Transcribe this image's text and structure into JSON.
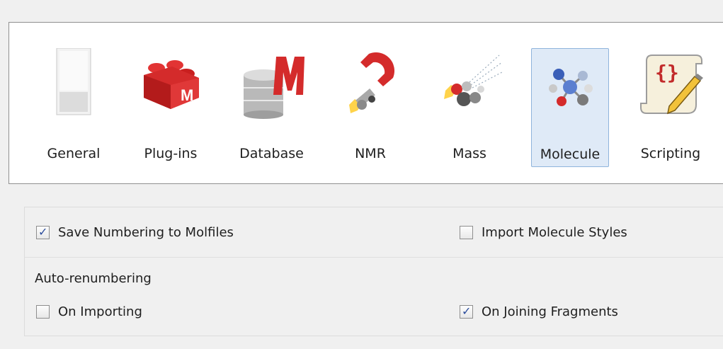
{
  "toolbar": {
    "items": [
      {
        "label": "General",
        "icon": "switch-icon",
        "selected": false
      },
      {
        "label": "Plug-ins",
        "icon": "lego-brick-icon",
        "selected": false
      },
      {
        "label": "Database",
        "icon": "database-icon",
        "selected": false
      },
      {
        "label": "NMR",
        "icon": "magnet-icon",
        "selected": false
      },
      {
        "label": "Mass",
        "icon": "mass-spec-icon",
        "selected": false
      },
      {
        "label": "Molecule",
        "icon": "molecule-icon",
        "selected": true
      },
      {
        "label": "Scripting",
        "icon": "script-scroll-icon",
        "selected": false
      }
    ]
  },
  "options": {
    "save_numbering": {
      "label": "Save Numbering to Molfiles",
      "checked": true
    },
    "import_styles": {
      "label": "Import Molecule Styles",
      "checked": false
    }
  },
  "auto_renumbering": {
    "title": "Auto-renumbering",
    "on_importing": {
      "label": "On Importing",
      "checked": false
    },
    "on_joining": {
      "label": "On Joining Fragments",
      "checked": true
    }
  },
  "colors": {
    "selected_bg": "#dfeaf7",
    "selected_border": "#8fb4dc",
    "brand_red": "#d42b2b"
  }
}
